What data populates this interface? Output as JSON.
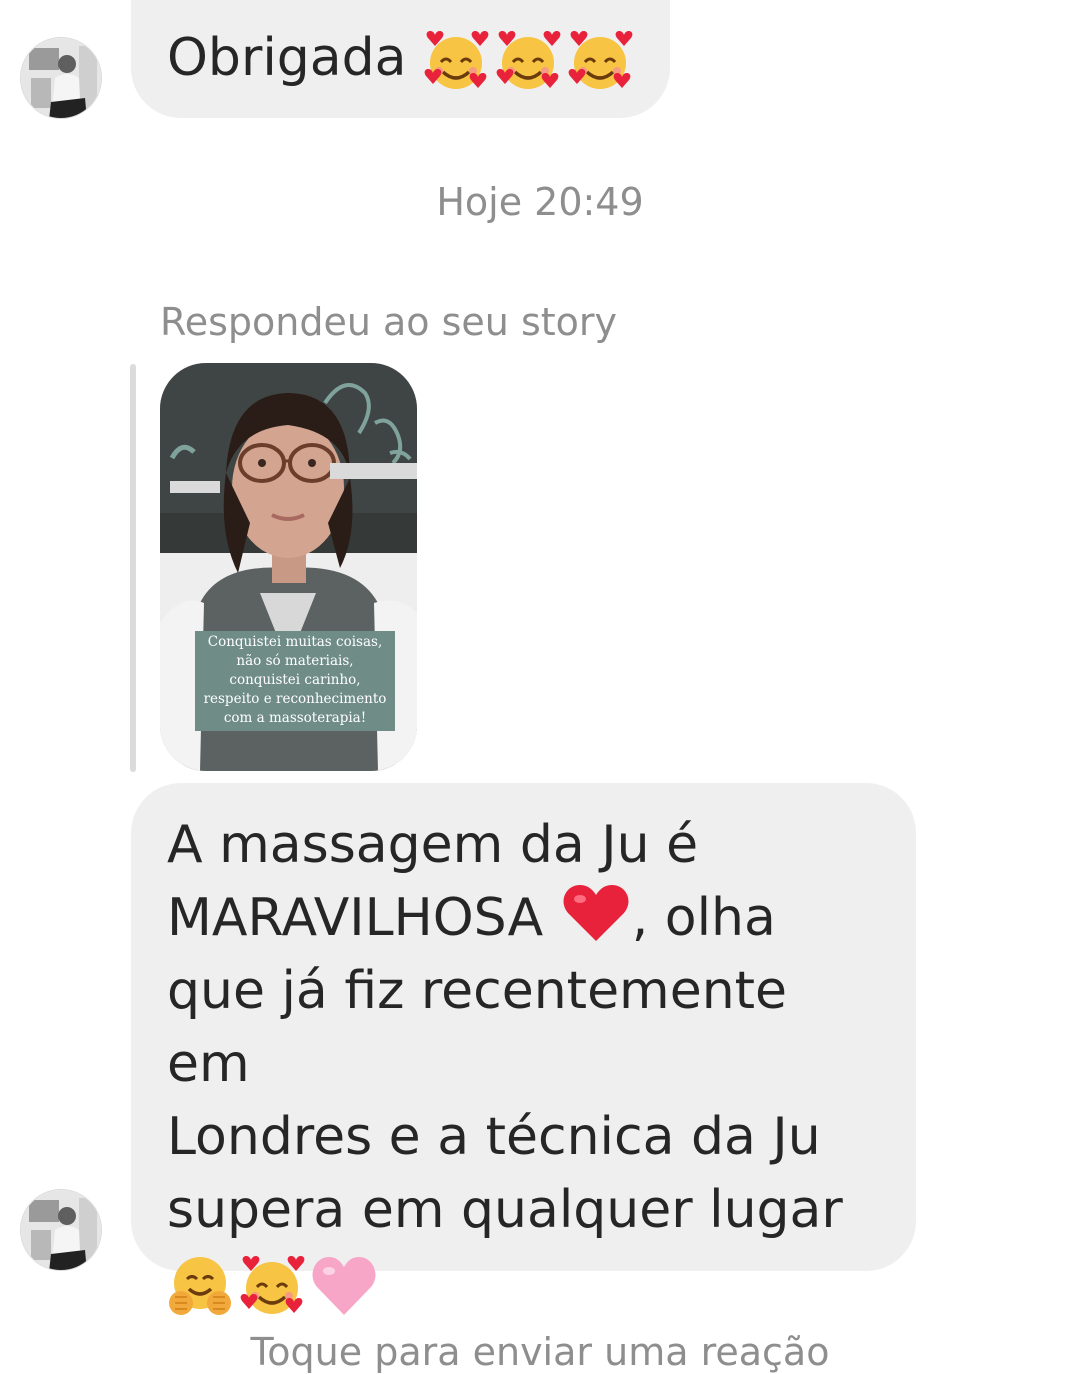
{
  "conversation": {
    "messages": [
      {
        "text": "Obrigada ",
        "emojis": [
          "smiling-face-with-hearts-emoji",
          "smiling-face-with-hearts-emoji",
          "smiling-face-with-hearts-emoji"
        ]
      },
      {
        "text_part1": "A massagem da Ju é\nMARAVILHOSA ",
        "text_part2": ", olha\nque já fiz recentemente em\nLondres e a técnica da Ju\nsupera em qualquer lugar\n",
        "inline_emoji": "red-heart-emoji",
        "trailing_emojis": [
          "hugging-face-emoji",
          "smiling-face-with-hearts-emoji",
          "pink-heart-emoji"
        ]
      }
    ],
    "timestamp": "Hoje 20:49",
    "reply_label": "Respondeu ao seu story",
    "story": {
      "caption": "Conquistei muitas coisas,\nnão só materiais,\nconquistei carinho,\nrespeito e reconhecimento\ncom a massoterapia!"
    },
    "footer_hint": "Toque para enviar uma reação"
  },
  "colors": {
    "bubble_bg": "#efefef",
    "secondary_text": "#8e8e8e",
    "primary_text": "#262626",
    "story_caption_bg": "#6f8c86"
  }
}
